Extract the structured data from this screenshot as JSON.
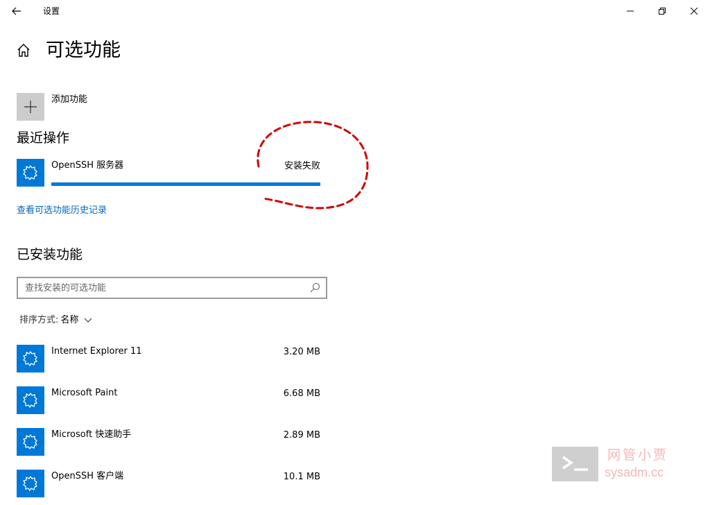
{
  "window": {
    "title": "设置"
  },
  "page": {
    "title": "可选功能"
  },
  "add_feature": {
    "label": "添加功能"
  },
  "recent": {
    "heading": "最近操作",
    "item": {
      "name": "OpenSSH 服务器",
      "status": "安装失败",
      "progress": 1.0
    },
    "history_link": "查看可选功能历史记录"
  },
  "installed": {
    "heading": "已安装功能",
    "search": {
      "placeholder": "查找安装的可选功能"
    },
    "sort": {
      "label": "排序方式:",
      "value": "名称"
    },
    "items": [
      {
        "name": "Internet Explorer 11",
        "size": "3.20 MB"
      },
      {
        "name": "Microsoft Paint",
        "size": "6.68 MB"
      },
      {
        "name": "Microsoft 快速助手",
        "size": "2.89 MB"
      },
      {
        "name": "OpenSSH 客户端",
        "size": "10.1 MB"
      }
    ]
  },
  "watermark": {
    "title": "网管小贾",
    "url": "sysadm.cc"
  },
  "colors": {
    "accent": "#0078d7",
    "link": "#0067c0",
    "annotation": "#d40000",
    "watermark_text": "#f4b6b6"
  },
  "icons": {
    "back": "back-arrow-icon",
    "home": "home-icon",
    "add": "plus-icon",
    "feature": "puzzle-gear-icon",
    "search": "search-icon",
    "sort": "chevron-down-icon"
  }
}
